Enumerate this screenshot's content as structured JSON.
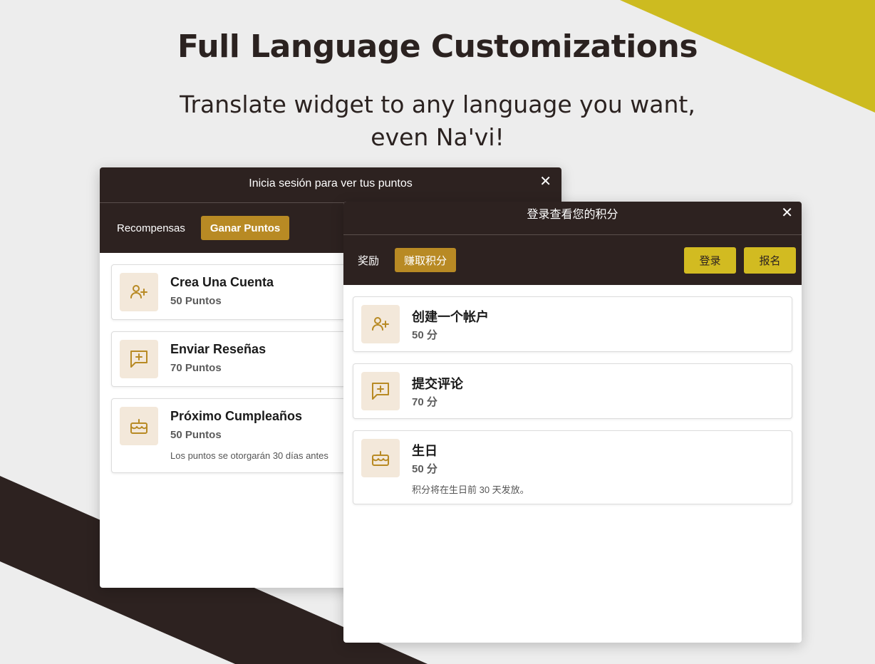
{
  "hero": {
    "title": "Full Language Customizations",
    "subtitle": "Translate widget to any language you want, even Na'vi!"
  },
  "colors": {
    "dark": "#2d2220",
    "gold": "#b88a24",
    "yellow": "#d2bb21",
    "icon_bg": "#f3e8da"
  },
  "spanish_widget": {
    "header": "Inicia sesión para ver tus puntos",
    "close": "✕",
    "nav": {
      "rewards": "Recompensas",
      "earn": "Ganar Puntos"
    },
    "items": [
      {
        "icon": "add-user-icon",
        "title": "Crea Una Cuenta",
        "points": "50 Puntos"
      },
      {
        "icon": "review-icon",
        "title": "Enviar Reseñas",
        "points": "70 Puntos"
      },
      {
        "icon": "birthday-cake-icon",
        "title": "Próximo Cumpleaños",
        "points": "50 Puntos",
        "note": "Los puntos se otorgarán 30 días antes"
      }
    ]
  },
  "chinese_widget": {
    "header": "登录查看您的积分",
    "close": "✕",
    "nav": {
      "rewards": "奖励",
      "earn": "赚取积分",
      "login": "登录",
      "signup": "报名"
    },
    "items": [
      {
        "icon": "add-user-icon",
        "title": "创建一个帐户",
        "points": "50 分"
      },
      {
        "icon": "review-icon",
        "title": "提交评论",
        "points": "70 分"
      },
      {
        "icon": "birthday-cake-icon",
        "title": "生日",
        "points": "50 分",
        "note": "积分将在生日前 30 天发放。"
      }
    ]
  }
}
